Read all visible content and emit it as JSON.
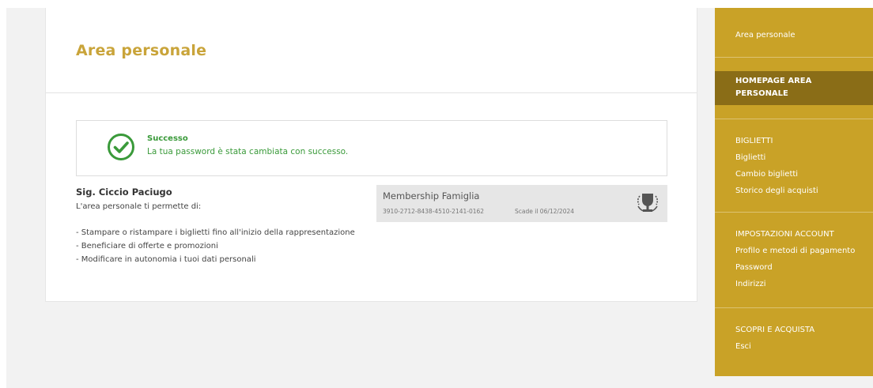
{
  "page": {
    "title": "Area personale"
  },
  "alert": {
    "title": "Successo",
    "message": "La tua password è stata cambiata con successo.",
    "icon": "check-circle-icon",
    "color": "#3a9a3a"
  },
  "user": {
    "name": "Sig. Ciccio Paciugo",
    "intro": "L'area personale ti permette di:",
    "benefits": [
      "- Stampare o ristampare i biglietti fino all'inizio della rappresentazione",
      "- Beneficiare di offerte e promozioni",
      "- Modificare in autonomia i tuoi dati personali"
    ]
  },
  "membership": {
    "name": "Membership Famiglia",
    "code": "3910-2712-8438-4510-2141-0162",
    "expiry": "Scade il 06/12/2024",
    "icon": "trophy-icon"
  },
  "sidebar": {
    "background": "#c9a227",
    "active_background": "#8a6d17",
    "top_link": "Area personale",
    "active_item": "HOMEPAGE AREA PERSONALE",
    "sections": [
      {
        "heading": "BIGLIETTI",
        "items": [
          "Biglietti",
          "Cambio biglietti",
          "Storico degli acquisti"
        ]
      },
      {
        "heading": "IMPOSTAZIONI ACCOUNT",
        "items": [
          "Profilo e metodi di pagamento",
          "Password",
          "Indirizzi"
        ]
      },
      {
        "heading": "SCOPRI E ACQUISTA",
        "items": [
          "Esci"
        ]
      }
    ]
  }
}
